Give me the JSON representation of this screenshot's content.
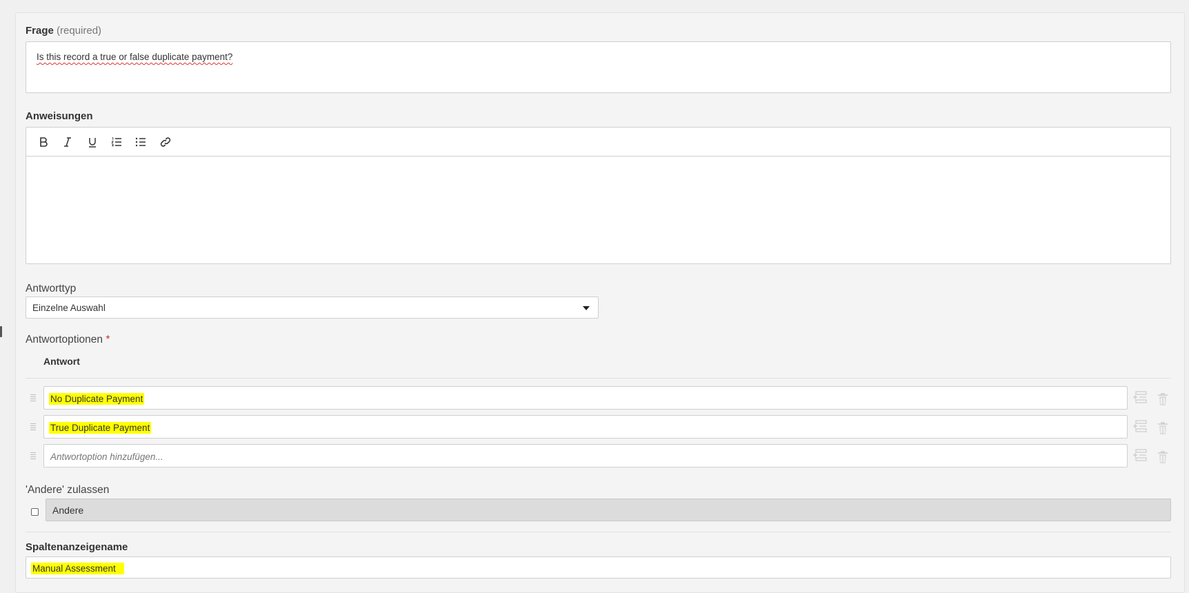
{
  "question": {
    "label": "Frage",
    "required_hint": "(required)",
    "value": "Is this record a true or false duplicate payment?"
  },
  "instructions": {
    "label": "Anweisungen",
    "toolbar": [
      {
        "name": "bold-button",
        "icon": "bold-icon"
      },
      {
        "name": "italic-button",
        "icon": "italic-icon"
      },
      {
        "name": "underline-button",
        "icon": "underline-icon"
      },
      {
        "name": "ordered-list-button",
        "icon": "ordered-list-icon"
      },
      {
        "name": "bullet-list-button",
        "icon": "bullet-list-icon"
      },
      {
        "name": "link-button",
        "icon": "link-icon"
      }
    ]
  },
  "answer_type": {
    "label": "Antworttyp",
    "selected": "Einzelne Auswahl"
  },
  "answer_options": {
    "label": "Antwortoptionen",
    "required_marker": "*",
    "column_header": "Antwort",
    "options": [
      {
        "value": "No Duplicate Payment"
      },
      {
        "value": "True Duplicate Payment"
      }
    ],
    "new_option_placeholder": "Antwortoption hinzufügen..."
  },
  "allow_other": {
    "label": "'Andere' zulassen",
    "checked": false,
    "value": "Andere"
  },
  "column_display_name": {
    "label": "Spaltenanzeigename",
    "value": "Manual Assessment"
  },
  "colors": {
    "highlight": "#ffff00",
    "required_marker": "#c0392b",
    "disabled_field": "#dcdcdc"
  }
}
